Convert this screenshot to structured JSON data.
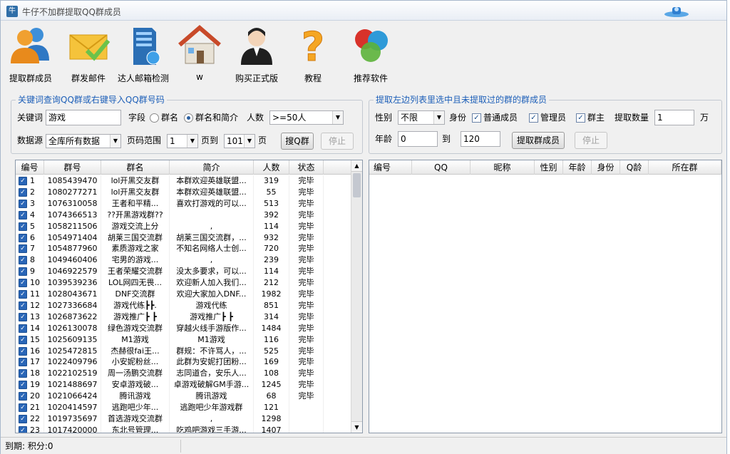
{
  "window": {
    "title": "牛仔不加群提取QQ群成员",
    "app_icon": "牛"
  },
  "toolbar": [
    {
      "label": "提取群成员",
      "icon": "users-icon"
    },
    {
      "label": "群发邮件",
      "icon": "mail-icon"
    },
    {
      "label": "达人邮箱检测",
      "icon": "server-icon"
    },
    {
      "label": "w",
      "icon": "home-icon"
    },
    {
      "label": "购买正式版",
      "icon": "support-agent-icon"
    },
    {
      "label": "教程",
      "icon": "help-icon"
    },
    {
      "label": "推荐软件",
      "icon": "circles-icon"
    }
  ],
  "left_panel": {
    "title": "关键词查询QQ群或右键导入QQ群号码",
    "keyword_label": "关键词",
    "keyword_value": "游戏",
    "field_label": "字段",
    "field_options": [
      "群名",
      "群名和简介"
    ],
    "field_selected": "群名和简介",
    "people_label": "人数",
    "people_value": ">=50人",
    "source_label": "数据源",
    "source_value": "全库所有数据",
    "page_range_label": "页码范围",
    "page_from": "1",
    "page_to_label": "页到",
    "page_to": "101",
    "page_unit": "页",
    "search_button": "搜Q群",
    "stop_button": "停止"
  },
  "right_panel": {
    "title": "提取左边列表里选中且未提取过的群的群成员",
    "gender_label": "性别",
    "gender_value": "不限",
    "role_label": "身份",
    "roles": [
      {
        "label": "普通成员",
        "checked": true
      },
      {
        "label": "管理员",
        "checked": true
      },
      {
        "label": "群主",
        "checked": true
      }
    ],
    "extract_count_label": "提取数量",
    "extract_count_value": "1",
    "extract_count_unit": "万",
    "age_label": "年龄",
    "age_from": "0",
    "age_to_label": "到",
    "age_to": "120",
    "extract_button": "提取群成员",
    "stop_button": "停止"
  },
  "group_table": {
    "columns": [
      "编号",
      "群号",
      "群名",
      "简介",
      "人数",
      "状态"
    ],
    "rows": [
      [
        "1",
        "1085439470",
        "lol开黑交友群",
        "本群欢迎英雄联盟...",
        "319",
        "完毕"
      ],
      [
        "2",
        "1080277271",
        "lol开黑交友群",
        "本群欢迎英雄联盟...",
        "55",
        "完毕"
      ],
      [
        "3",
        "1076310058",
        "王者和平精...",
        "喜欢打游戏的可以...",
        "513",
        "完毕"
      ],
      [
        "4",
        "1074366513",
        "??开黑游戏群??",
        "",
        "392",
        "完毕"
      ],
      [
        "5",
        "1058211506",
        "游戏交流上分",
        ",",
        "114",
        "完毕"
      ],
      [
        "6",
        "1054971404",
        "胡莱三国交流群",
        "胡莱三国交流群，...",
        "932",
        "完毕"
      ],
      [
        "7",
        "1054877960",
        "素质游戏之家",
        "不知名网络人士创...",
        "720",
        "完毕"
      ],
      [
        "8",
        "1049460406",
        "宅男的游戏...",
        ",",
        "239",
        "完毕"
      ],
      [
        "9",
        "1046922579",
        "王者荣耀交流群",
        "没太多要求，可以...",
        "114",
        "完毕"
      ],
      [
        "10",
        "1039539236",
        "LOL网四无畏...",
        "欢迎新人加入我们...",
        "212",
        "完毕"
      ],
      [
        "11",
        "1028043671",
        "DNF交流群",
        "欢迎大家加入DNF...",
        "1982",
        "完毕"
      ],
      [
        "12",
        "1027336684",
        "游戏代练┣┣.",
        "游戏代练",
        "851",
        "完毕"
      ],
      [
        "13",
        "1026873622",
        "游戏推广┣ ┣",
        "游戏推广┣ ┣",
        "314",
        "完毕"
      ],
      [
        "14",
        "1026130078",
        "绿色游戏交流群",
        "穿越火线手游版作...",
        "1484",
        "完毕"
      ],
      [
        "15",
        "1025609135",
        "M1游戏",
        "M1游戏",
        "116",
        "完毕"
      ],
      [
        "16",
        "1025472815",
        "杰赫很fai王...",
        "群规：不许骂人，...",
        "525",
        "完毕"
      ],
      [
        "17",
        "1022409796",
        "小安妮粉丝...",
        "此群为安妮打团粉...",
        "169",
        "完毕"
      ],
      [
        "18",
        "1022102519",
        "周一汤鹏交流群",
        "志同道合，安乐人...",
        "108",
        "完毕"
      ],
      [
        "19",
        "1021488697",
        "安卓游戏破...",
        "卓游戏破解GM手游...",
        "1245",
        "完毕"
      ],
      [
        "20",
        "1021066424",
        "腾讯游戏",
        "腾讯游戏",
        "68",
        "完毕"
      ],
      [
        "21",
        "1020414597",
        "逃跑吧少年...",
        "逃跑吧少年游戏群",
        "121",
        ""
      ],
      [
        "22",
        "1019735697",
        "首选游戏交流群",
        ",",
        "1298",
        ""
      ],
      [
        "23",
        "1017420000",
        "东北号管理...",
        "吃鸡吧游戏三手游...",
        "1407",
        ""
      ]
    ]
  },
  "member_table": {
    "columns": [
      "编号",
      "QQ",
      "昵称",
      "性别",
      "年龄",
      "身份",
      "Q龄",
      "所在群"
    ]
  },
  "status_bar": {
    "text": "到期: 积分:0"
  }
}
